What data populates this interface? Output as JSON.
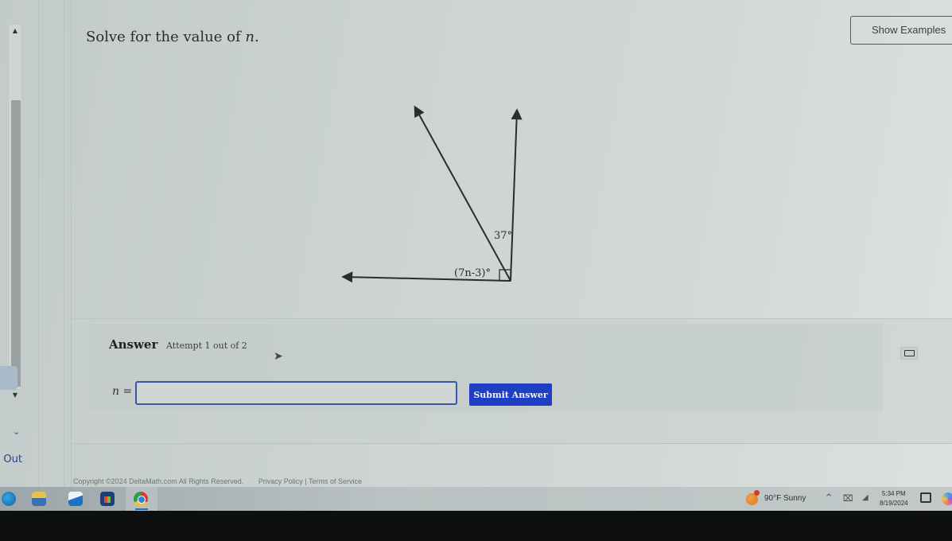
{
  "question": {
    "prefix": "Solve for the value of ",
    "variable": "n",
    "suffix": "."
  },
  "header": {
    "show_examples_label": "Show Examples"
  },
  "diagram": {
    "angle_top_label": "37°",
    "angle_bottom_label": "(7n-3)°",
    "right_angle_marker": true
  },
  "answer": {
    "label": "Answer",
    "attempt_text": "Attempt 1 out of 2",
    "input_prefix_var": "n",
    "input_prefix_eq": " =",
    "input_value": "",
    "submit_label": "Submit Answer",
    "keyboard_icon": "keyboard-icon"
  },
  "left_nav": {
    "logout_label": "g Out",
    "chevron": "⌄"
  },
  "footer": {
    "copyright": "Copyright ©2024 DeltaMath.com All Rights Reserved.",
    "links": "Privacy Policy | Terms of Service"
  },
  "taskbar": {
    "apps": [
      "edge-icon",
      "file-explorer-icon",
      "mail-icon",
      "store-icon",
      "chrome-icon"
    ],
    "weather": "90°F  Sunny",
    "time": "5:34 PM",
    "date": "8/19/2024"
  },
  "colors": {
    "submit": "#1e3fc4",
    "input_border": "#3d55a6",
    "logout": "#2f3f8c"
  }
}
